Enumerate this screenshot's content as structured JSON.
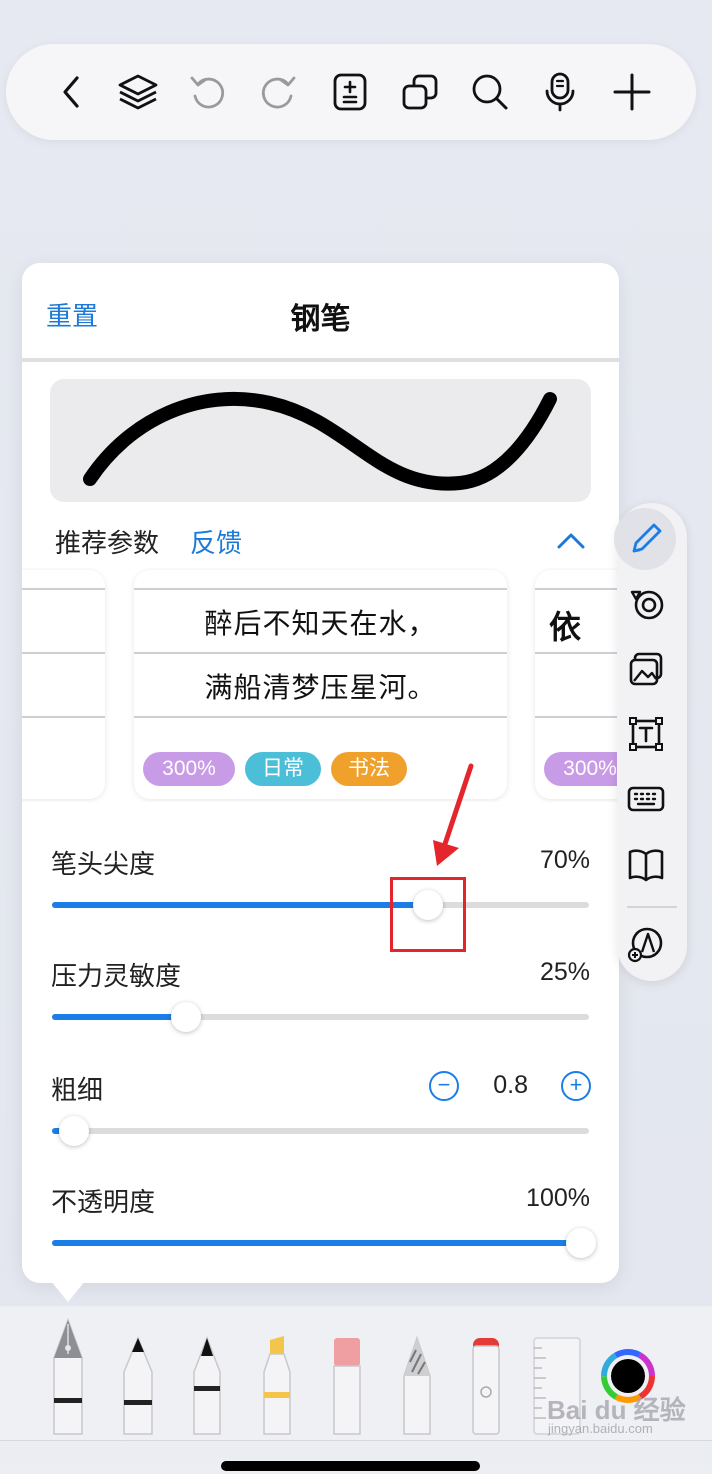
{
  "toolbar": {
    "icons": [
      "back-chevron-icon",
      "layers-icon",
      "undo-icon",
      "redo-icon",
      "page-adjust-icon",
      "duplicate-icon",
      "search-icon",
      "microphone-icon",
      "add-icon"
    ]
  },
  "panel": {
    "reset_label": "重置",
    "title": "钢笔",
    "recommended_label": "推荐参数",
    "feedback_label": "反馈",
    "cards": [
      {
        "lines": [
          "",
          ""
        ],
        "tags": []
      },
      {
        "lines": [
          "醉后不知天在水，",
          "满船清梦压星河。"
        ],
        "tags": [
          "300%",
          "日常",
          "书法"
        ]
      },
      {
        "lines": [
          "依",
          ""
        ],
        "tags": [
          "300%"
        ]
      }
    ]
  },
  "sliders": {
    "tip_sharpness": {
      "label": "笔头尖度",
      "value": "70%",
      "fraction": 0.7
    },
    "pressure": {
      "label": "压力灵敏度",
      "value": "25%",
      "fraction": 0.25
    },
    "thickness": {
      "label": "粗细",
      "value": "0.8",
      "fraction": 0.04,
      "minus": "−",
      "plus": "+"
    },
    "opacity": {
      "label": "不透明度",
      "value": "100%",
      "fraction": 1.0
    }
  },
  "rail": {
    "icons": [
      "pen-icon",
      "shapes-icon",
      "image-icon",
      "textbox-icon",
      "keyboard-icon",
      "book-icon",
      "add-tool-icon"
    ],
    "active": "pen-icon"
  },
  "tray": {
    "pens": [
      "fountain-pen",
      "ballpoint-pen",
      "fineliner-pen",
      "highlighter",
      "eraser",
      "pencil",
      "marker",
      "ruler"
    ],
    "color_picker": "color-wheel-icon"
  },
  "colors": {
    "accent": "#1b7ee6",
    "annotation": "#e4262c",
    "tag_purple": "#c89be6",
    "tag_cyan": "#4bbfd8",
    "tag_orange": "#f0a12c"
  },
  "watermark": {
    "text": "Bai du 经验",
    "sub": "jingyan.baidu.com"
  }
}
